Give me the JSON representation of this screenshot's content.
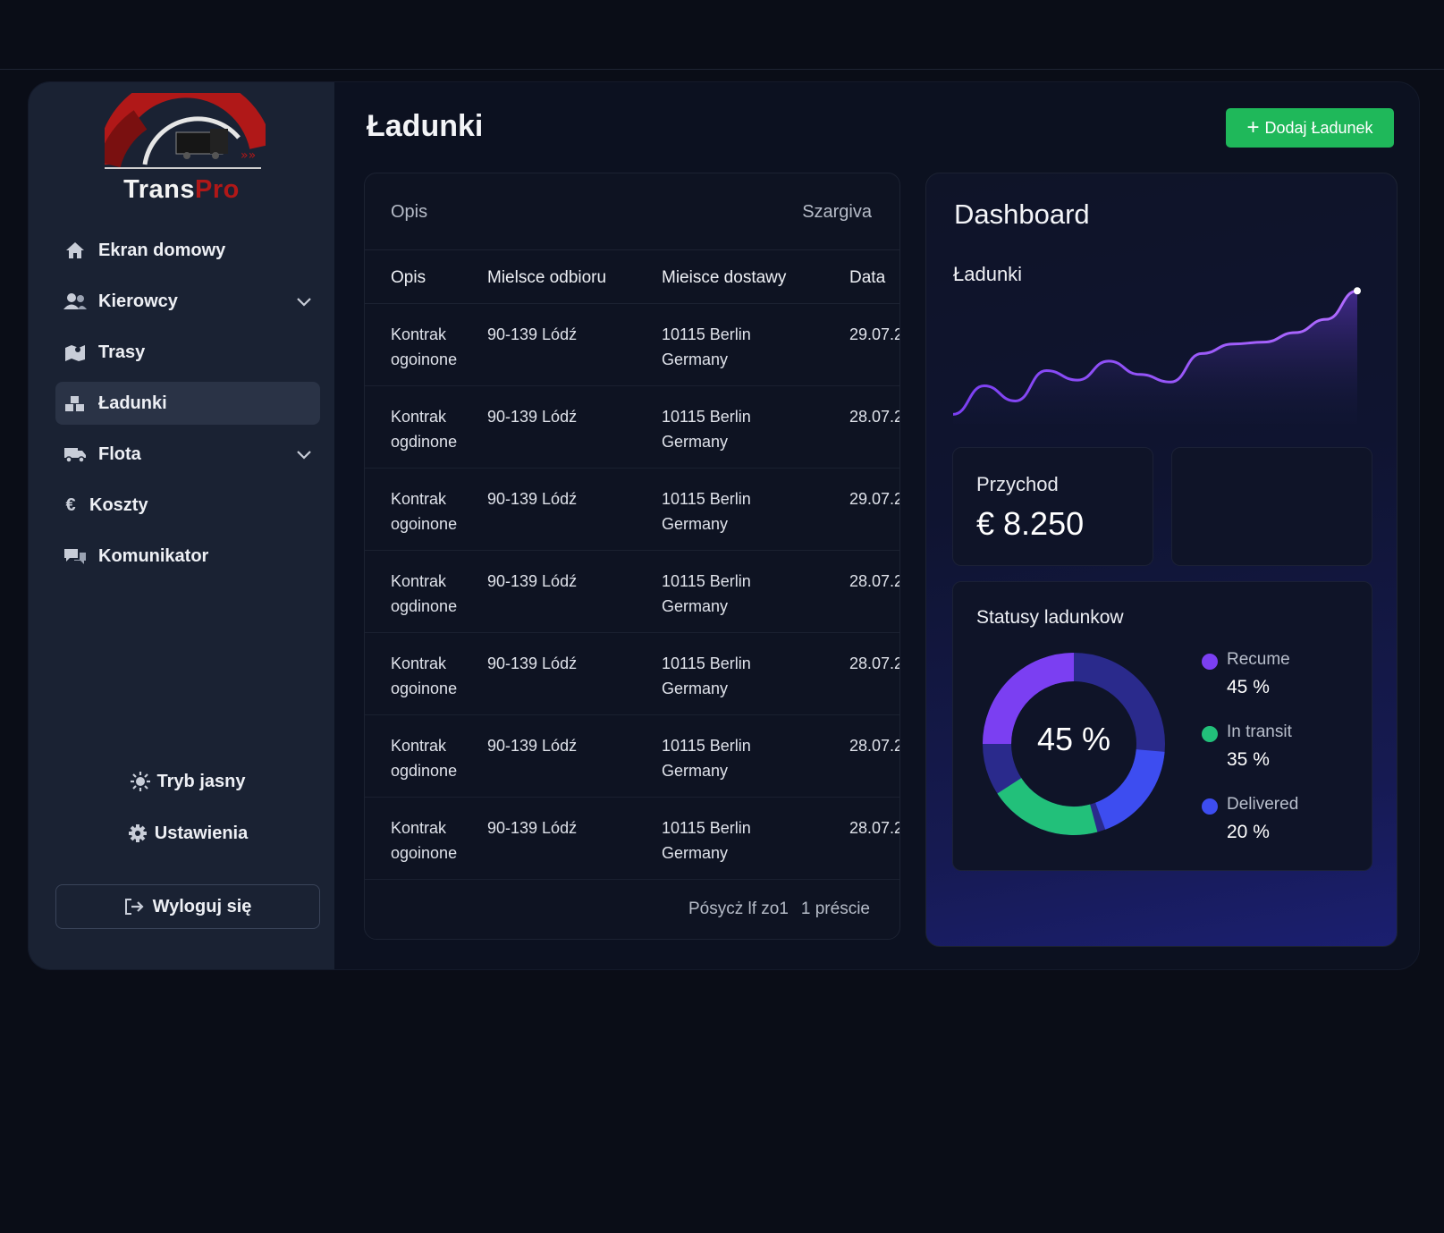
{
  "brand": {
    "name_part1": "Trans",
    "name_part2": "Pro"
  },
  "sidebar": {
    "items": [
      {
        "label": "Ekran domowy",
        "icon": "home-icon"
      },
      {
        "label": "Kierowcy",
        "icon": "users-icon",
        "expandable": true
      },
      {
        "label": "Trasy",
        "icon": "map-icon"
      },
      {
        "label": "Ładunki",
        "icon": "boxes-icon",
        "active": true
      },
      {
        "label": "Flota",
        "icon": "truck-icon",
        "expandable": true
      },
      {
        "label": "Koszty",
        "icon": "euro-icon"
      },
      {
        "label": "Komunikator",
        "icon": "chat-icon"
      }
    ],
    "light_mode_label": "Tryb jasny",
    "settings_label": "Ustawienia",
    "logout_label": "Wyloguj się"
  },
  "page": {
    "title": "Ładunki",
    "add_button_label": "Dodaj Ładunek"
  },
  "table": {
    "header_left": "Opis",
    "header_right": "Szargiva",
    "columns": [
      "Opis",
      "Mielsce odbioru",
      "Mieisce dostawy",
      "Data"
    ],
    "rows": [
      {
        "desc1": "Kontrak",
        "desc2": "ogoinone",
        "pickup": "90-139 Lódź",
        "dest1": "10115 Berlin",
        "dest2": "Germany",
        "date": "29.07.2"
      },
      {
        "desc1": "Kontrak",
        "desc2": "ogdinone",
        "pickup": "90-139 Lódź",
        "dest1": "10115 Berlin",
        "dest2": "Germany",
        "date": "28.07.2"
      },
      {
        "desc1": "Kontrak",
        "desc2": "ogoinone",
        "pickup": "90-139 Lódź",
        "dest1": "10115 Berlin",
        "dest2": "Germany",
        "date": "29.07.2"
      },
      {
        "desc1": "Kontrak",
        "desc2": "ogdinone",
        "pickup": "90-139 Lódź",
        "dest1": "10115 Berlin",
        "dest2": "Germany",
        "date": "28.07.2"
      },
      {
        "desc1": "Kontrak",
        "desc2": "ogoinone",
        "pickup": "90-139 Lódź",
        "dest1": "10115 Berlin",
        "dest2": "Germany",
        "date": "28.07.2"
      },
      {
        "desc1": "Kontrak",
        "desc2": "ogdinone",
        "pickup": "90-139 Lódź",
        "dest1": "10115 Berlin",
        "dest2": "Germany",
        "date": "28.07.2"
      },
      {
        "desc1": "Kontrak",
        "desc2": "ogoinone",
        "pickup": "90-139 Lódź",
        "dest1": "10115 Berlin",
        "dest2": "Germany",
        "date": "28.07.2"
      }
    ],
    "pager_text": "Pósycż lf zo1",
    "pager_pages": "1 préscie"
  },
  "dashboard": {
    "title": "Dashboard",
    "chart_label": "Ładunki",
    "revenue_label": "Przychod",
    "revenue_value": "€ 8.250",
    "status_title": "Statusy ladunkow",
    "donut_center": "45 %",
    "colors": {
      "recume": "#7b3ff2",
      "in_transit": "#22c07a",
      "delivered": "#3d4df0",
      "track": "#2a2a8c"
    }
  },
  "chart_data": [
    {
      "type": "area",
      "title": "Ładunki",
      "x": [
        0,
        1,
        2,
        3,
        4,
        5,
        6,
        7,
        8,
        9,
        10,
        11,
        12,
        13
      ],
      "values": [
        10,
        40,
        24,
        56,
        46,
        66,
        52,
        44,
        74,
        84,
        86,
        96,
        110,
        140
      ],
      "ylim": [
        0,
        160
      ],
      "grid": false
    },
    {
      "type": "pie",
      "categories": [
        "Recume",
        "In transit",
        "Delivered"
      ],
      "labels": [
        "45 %",
        "35 %",
        "20 %"
      ],
      "values": [
        45,
        35,
        20
      ],
      "legend": "right"
    }
  ]
}
